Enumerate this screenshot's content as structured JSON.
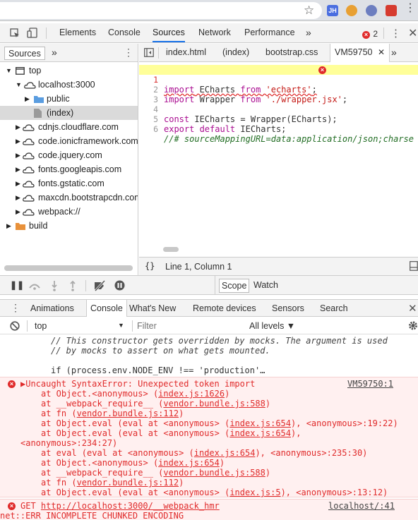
{
  "browser": {
    "ext_jh": "JH",
    "star_icon": "☆"
  },
  "devtools": {
    "tabs": [
      "Elements",
      "Console",
      "Sources",
      "Network",
      "Performance"
    ],
    "more": "»",
    "error_count": "2",
    "active_tab": "Sources"
  },
  "navigator": {
    "tab": "Sources",
    "more": "»",
    "tree": [
      {
        "label": "top",
        "kind": "frame"
      },
      {
        "label": "localhost:3000",
        "kind": "cloud"
      },
      {
        "label": "public",
        "kind": "folder"
      },
      {
        "label": "(index)",
        "kind": "file"
      },
      {
        "label": "cdnjs.cloudflare.com",
        "kind": "cloud"
      },
      {
        "label": "code.ionicframework.com",
        "kind": "cloud"
      },
      {
        "label": "code.jquery.com",
        "kind": "cloud"
      },
      {
        "label": "fonts.googleapis.com",
        "kind": "cloud"
      },
      {
        "label": "fonts.gstatic.com",
        "kind": "cloud"
      },
      {
        "label": "maxcdn.bootstrapcdn.com",
        "kind": "cloud"
      },
      {
        "label": "webpack://",
        "kind": "cloud"
      },
      {
        "label": "build",
        "kind": "folder"
      }
    ]
  },
  "editor": {
    "tabs": [
      "index.html",
      "(index)",
      "bootstrap.css",
      "VM59750"
    ],
    "more": "»",
    "lines": [
      {
        "n": "1",
        "text": "import ECharts from 'echarts';"
      },
      {
        "n": "2",
        "text": "import Wrapper from './wrapper.jsx';"
      },
      {
        "n": "3",
        "text": ""
      },
      {
        "n": "4",
        "text": "const IECharts = Wrapper(ECharts);"
      },
      {
        "n": "5",
        "text": "export default IECharts;"
      },
      {
        "n": "6",
        "text": "//# sourceMappingURL=data:application/json;charse"
      }
    ],
    "status": "Line 1, Column 1",
    "braces": "{}"
  },
  "debugger": {
    "scope_tab": "Scope",
    "watch_tab": "Watch"
  },
  "drawer": {
    "tabs": [
      "Animations",
      "Console",
      "What's New",
      "Remote devices",
      "Sensors",
      "Search"
    ],
    "active_tab": "Console"
  },
  "console_toolbar": {
    "context": "top",
    "filter_placeholder": "Filter",
    "levels": "All levels ▼"
  },
  "console": {
    "comment_lines": [
      "// This constructor gets overridden by mocks. The argument is used",
      "// by mocks to assert on what gets mounted.",
      "",
      "if (process.env.NODE_ENV !== 'production'…"
    ],
    "error1": {
      "message": "▶Uncaught SyntaxError: Unexpected token import",
      "source": "VM59750:1",
      "stack": [
        {
          "pre": "at Object.<anonymous> (",
          "link": "index.js:1626",
          "post": ")"
        },
        {
          "pre": "at __webpack_require__ (",
          "link": "vendor.bundle.js:588",
          "post": ")"
        },
        {
          "pre": "at fn (",
          "link": "vendor.bundle.js:112",
          "post": ")"
        },
        {
          "pre": "at Object.eval (eval at <anonymous> (",
          "link": "index.js:654",
          "post": "), <anonymous>:19:22)"
        },
        {
          "pre": "at Object.eval (eval at <anonymous> (",
          "link": "index.js:654",
          "post": "),"
        },
        {
          "pre": "<anonymous>:234:27)",
          "link": "",
          "post": ""
        },
        {
          "pre": "at eval (eval at <anonymous> (",
          "link": "index.js:654",
          "post": "), <anonymous>:235:30)"
        },
        {
          "pre": "at Object.<anonymous> (",
          "link": "index.js:654",
          "post": ")"
        },
        {
          "pre": "at __webpack_require__ (",
          "link": "vendor.bundle.js:588",
          "post": ")"
        },
        {
          "pre": "at fn (",
          "link": "vendor.bundle.js:112",
          "post": ")"
        },
        {
          "pre": "at Object.eval (eval at <anonymous> (",
          "link": "index.js:5",
          "post": "), <anonymous>:13:12)"
        }
      ]
    },
    "error2": {
      "method": "GET",
      "url": "http://localhost:3000/__webpack_hmr",
      "source": "localhost/:41",
      "detail": "net::ERR_INCOMPLETE_CHUNKED_ENCODING"
    }
  },
  "colors": {
    "accent": "#1a73e8",
    "error": "#e02b2b",
    "error_bg": "#fff0f0",
    "highlight_line": "#ffff99",
    "keyword": "#aa0d91",
    "string": "#c41a16"
  }
}
